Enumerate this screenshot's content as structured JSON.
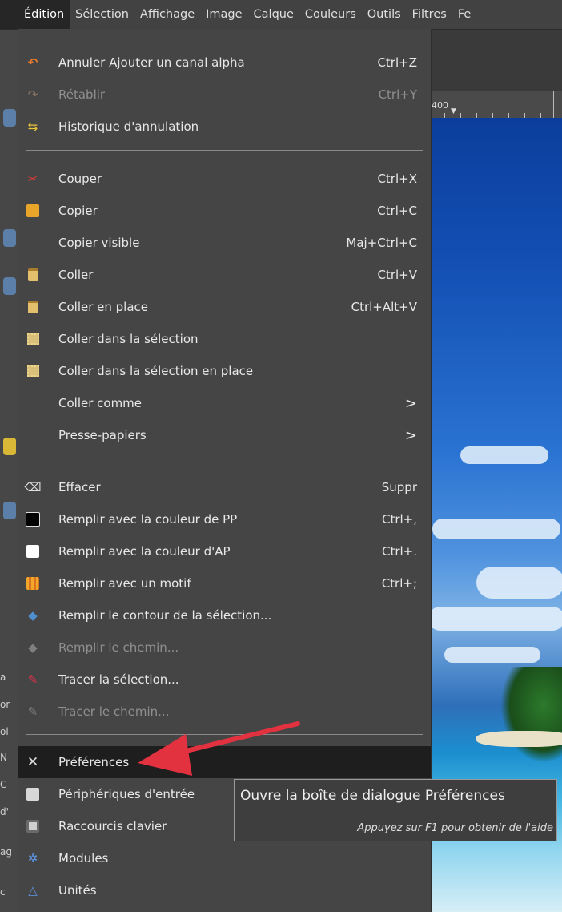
{
  "menubar": {
    "items": [
      "Édition",
      "Sélection",
      "Affichage",
      "Image",
      "Calque",
      "Couleurs",
      "Outils",
      "Filtres",
      "Fe"
    ],
    "active": "Édition"
  },
  "ruler": {
    "label": "400"
  },
  "left_strip_labels": [
    "a",
    "or",
    "ol",
    "N",
    "C",
    "d'",
    "ag",
    "c"
  ],
  "menu": {
    "items": [
      {
        "label": "Annuler Ajouter un canal alpha",
        "shortcut": "Ctrl+Z",
        "icon": "undo-icon"
      },
      {
        "label": "Rétablir",
        "shortcut": "Ctrl+Y",
        "icon": "redo-icon",
        "disabled": true
      },
      {
        "label": "Historique d'annulation",
        "shortcut": "",
        "icon": "undo-history-icon"
      },
      {
        "label": "Couper",
        "shortcut": "Ctrl+X",
        "icon": "cut-icon"
      },
      {
        "label": "Copier",
        "shortcut": "Ctrl+C",
        "icon": "copy-icon"
      },
      {
        "label": "Copier visible",
        "shortcut": "Maj+Ctrl+C",
        "icon": ""
      },
      {
        "label": "Coller",
        "shortcut": "Ctrl+V",
        "icon": "paste-icon"
      },
      {
        "label": "Coller en place",
        "shortcut": "Ctrl+Alt+V",
        "icon": "paste-in-place-icon"
      },
      {
        "label": "Coller dans la sélection",
        "shortcut": "",
        "icon": "paste-into-selection-icon"
      },
      {
        "label": "Coller dans la sélection en place",
        "shortcut": "",
        "icon": "paste-into-selection-in-place-icon"
      },
      {
        "label": "Coller comme",
        "shortcut": "",
        "icon": "",
        "submenu": true
      },
      {
        "label": "Presse-papiers",
        "shortcut": "",
        "icon": "",
        "submenu": true
      },
      {
        "label": "Effacer",
        "shortcut": "Suppr",
        "icon": "clear-icon"
      },
      {
        "label": "Remplir avec la couleur de PP",
        "shortcut": "Ctrl+,",
        "icon": "fg-color-icon"
      },
      {
        "label": "Remplir avec la couleur d'AP",
        "shortcut": "Ctrl+.",
        "icon": "bg-color-icon"
      },
      {
        "label": "Remplir avec un motif",
        "shortcut": "Ctrl+;",
        "icon": "pattern-icon"
      },
      {
        "label": "Remplir le contour de la sélection...",
        "shortcut": "",
        "icon": "fill-selection-outline-icon"
      },
      {
        "label": "Remplir le chemin...",
        "shortcut": "",
        "icon": "fill-path-icon",
        "disabled": true
      },
      {
        "label": "Tracer la sélection...",
        "shortcut": "",
        "icon": "stroke-selection-icon"
      },
      {
        "label": "Tracer le chemin...",
        "shortcut": "",
        "icon": "stroke-path-icon",
        "disabled": true
      },
      {
        "label": "Préférences",
        "shortcut": "",
        "icon": "preferences-icon",
        "highlighted": true
      },
      {
        "label": "Périphériques d'entrée",
        "shortcut": "",
        "icon": "input-devices-icon"
      },
      {
        "label": "Raccourcis clavier",
        "shortcut": "",
        "icon": "keyboard-shortcuts-icon"
      },
      {
        "label": "Modules",
        "shortcut": "",
        "icon": "modules-icon"
      },
      {
        "label": "Unités",
        "shortcut": "",
        "icon": "units-icon"
      }
    ],
    "submenu_glyph": ">"
  },
  "tooltip": {
    "title": "Ouvre la boîte de dialogue Préférences",
    "hint": "Appuyez sur F1 pour obtenir de l'aide"
  },
  "colors": {
    "menu_bg": "#454545",
    "highlight_bg": "#1e1e1e",
    "annotation_arrow": "#e2313f"
  }
}
